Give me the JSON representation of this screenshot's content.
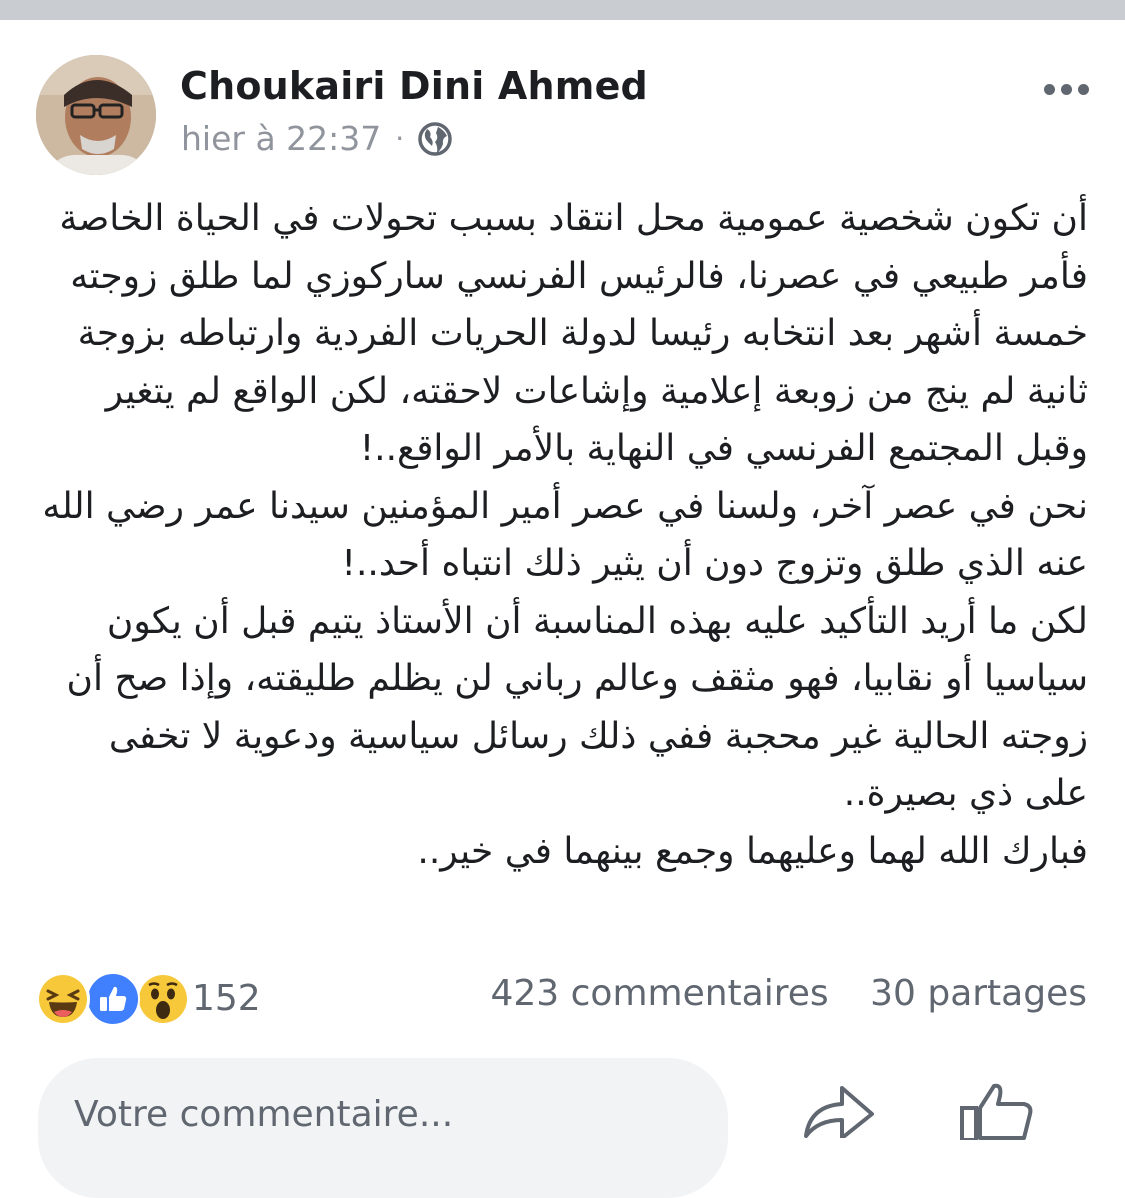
{
  "post": {
    "author": "Choukairi Dini Ahmed",
    "timestamp": "hier à 22:37",
    "separator": "·",
    "privacy_icon": "globe-icon",
    "paragraphs": [
      "أن تكون شخصية عمومية محل انتقاد بسبب تحولات في الحياة الخاصة فأمر طبيعي في عصرنا، فالرئيس الفرنسي ساركوزي لما طلق زوجته خمسة أشهر بعد انتخابه رئيسا لدولة الحريات الفردية وارتباطه بزوجة ثانية لم ينج من زوبعة إعلامية وإشاعات لاحقته، لكن الواقع لم يتغير وقبل المجتمع الفرنسي في النهاية بالأمر الواقع..!",
      "نحن في عصر آخر، ولسنا في عصر أمير المؤمنين سيدنا عمر رضي الله عنه الذي طلق وتزوج دون أن يثير ذلك انتباه أحد..!",
      "لكن ما أريد التأكيد عليه بهذه المناسبة أن الأستاذ يتيم قبل أن يكون سياسيا أو نقابيا، فهو مثقف وعالم رباني لن يظلم طليقته، وإذا صح أن زوجته الحالية غير محجبة ففي ذلك رسائل سياسية ودعوية لا تخفى على ذي بصيرة..",
      "فبارك الله لهما وعليهما وجمع بينهما في خير.."
    ]
  },
  "stats": {
    "reaction_icons": [
      "haha-icon",
      "like-icon",
      "wow-icon"
    ],
    "reactions_count": "152",
    "comments": "423 commentaires",
    "shares": "30 partages"
  },
  "composer": {
    "placeholder": "Votre commentaire..."
  },
  "colors": {
    "like_blue": "#4080ff",
    "emoji_yellow": "#f7c83a",
    "secondary_text": "#90949c"
  }
}
